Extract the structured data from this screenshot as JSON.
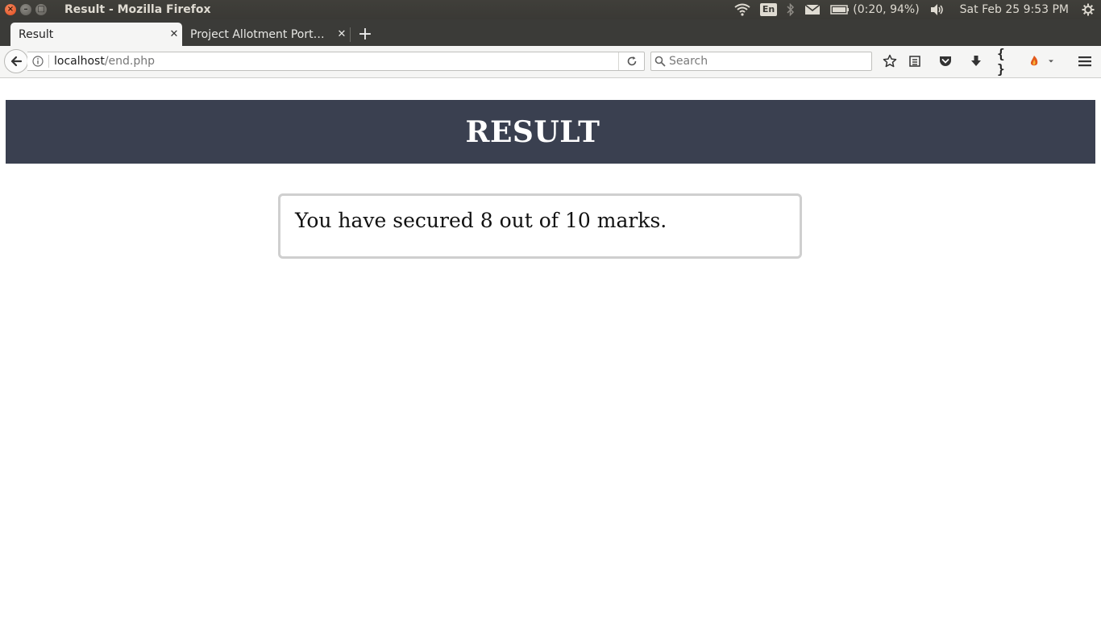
{
  "window": {
    "title": "Result - Mozilla Firefox"
  },
  "system_tray": {
    "keyboard_layout": "En",
    "battery_text": "(0:20, 94%)",
    "datetime": "Sat Feb 25  9:53 PM"
  },
  "tabs": [
    {
      "label": "Result",
      "active": true
    },
    {
      "label": "Project Allotment Port…",
      "active": false
    }
  ],
  "navbar": {
    "url_host": "localhost",
    "url_path": "/end.php",
    "search_placeholder": "Search"
  },
  "page": {
    "header_title": "RESULT",
    "score_message": "You have secured 8 out of 10 marks.",
    "header_bg": "#3a4050"
  }
}
